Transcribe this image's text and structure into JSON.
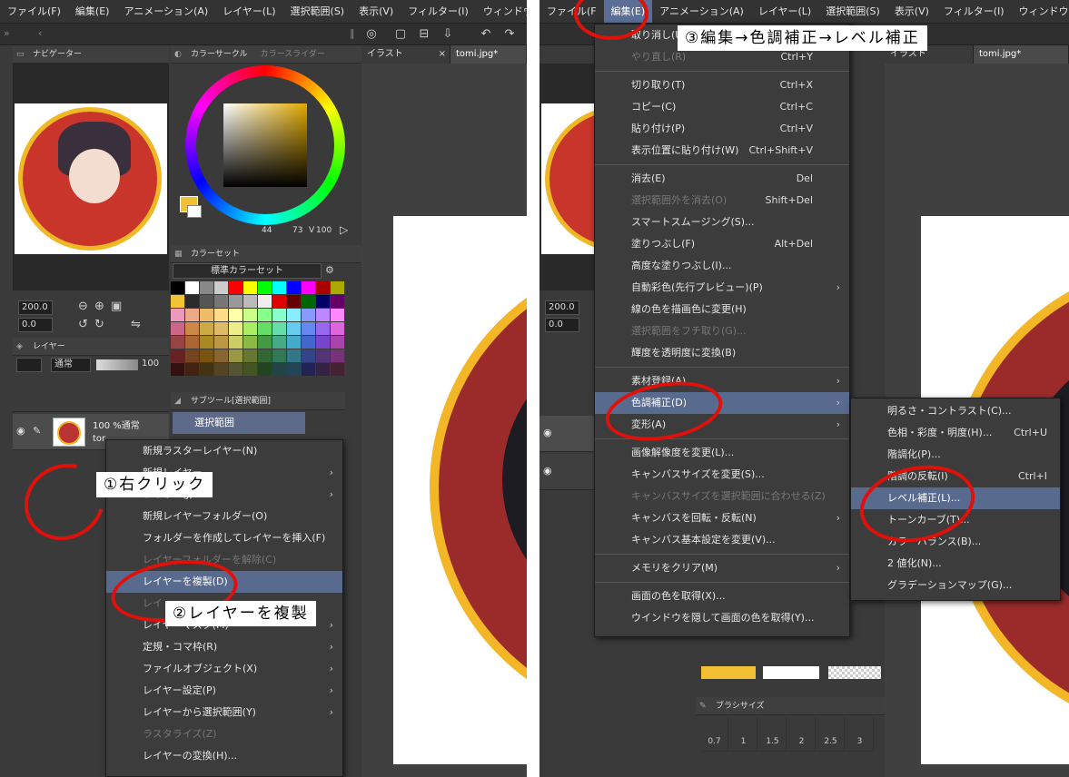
{
  "menus": {
    "left": [
      "ファイル(F)",
      "編集(E)",
      "アニメーション(A)",
      "レイヤー(L)",
      "選択範囲(S)",
      "表示(V)",
      "フィルター(I)",
      "ウィンドウ(W"
    ],
    "right": [
      "ファイル(F",
      "編集(E)",
      "アニメーション(A)",
      "レイヤー(L)",
      "選択範囲(S)",
      "表示(V)",
      "フィルター(I)",
      "ウィンドウ(W)"
    ]
  },
  "panels": {
    "navigator": "ナビゲーター",
    "color_circle": "カラーサークル",
    "color_slider": "カラースライダー",
    "color_set": "カラーセット",
    "color_set_name": "標準カラーセット",
    "layer": "レイヤー",
    "sub_tool": "サブツール[選択範囲]",
    "sub_tool_item": "選択範囲",
    "brush_size": "ブラシサイズ"
  },
  "color_values": {
    "h": "44",
    "s": "73",
    "v": "V",
    "v_val": "100"
  },
  "nav": {
    "zoom": "200.0",
    "angle": "0.0"
  },
  "layer": {
    "blend": "通常",
    "opacity": "100",
    "row_label": "100 %通常",
    "row_name": "tor"
  },
  "tabs": {
    "illust": "イラスト",
    "file": "tomi.jpg*"
  },
  "context_menu": {
    "items": [
      {
        "label": "新規ラスターレイヤー(N)",
        "dis": false,
        "arrow": false
      },
      {
        "label": "新規レイヤー",
        "dis": false,
        "arrow": true
      },
      {
        "label": "レイヤー(J)",
        "dis": false,
        "arrow": true
      },
      {
        "label": "新規レイヤーフォルダー(O)",
        "dis": false,
        "arrow": false
      },
      {
        "label": "フォルダーを作成してレイヤーを挿入(F)",
        "dis": false,
        "arrow": false
      },
      {
        "label": "レイヤーフォルダーを解除(C)",
        "dis": true,
        "arrow": false
      },
      {
        "label": "レイヤーを複製(D)",
        "dis": false,
        "arrow": false,
        "sel": true
      },
      {
        "label": "レイ",
        "dis": true,
        "arrow": false
      },
      {
        "label": "レイヤーマスク(M)",
        "dis": false,
        "arrow": true
      },
      {
        "label": "定規・コマ枠(R)",
        "dis": false,
        "arrow": true
      },
      {
        "label": "ファイルオブジェクト(X)",
        "dis": false,
        "arrow": true
      },
      {
        "label": "レイヤー設定(P)",
        "dis": false,
        "arrow": true
      },
      {
        "label": "レイヤーから選択範囲(Y)",
        "dis": false,
        "arrow": true
      },
      {
        "label": "ラスタライズ(Z)",
        "dis": true,
        "arrow": false
      },
      {
        "label": "レイヤーの変換(H)...",
        "dis": false,
        "arrow": false
      }
    ]
  },
  "edit_menu": {
    "items": [
      {
        "label": "取り消し(U)",
        "sc": "",
        "dis": false
      },
      {
        "label": "やり直し(R)",
        "sc": "Ctrl+Y",
        "dis": true
      },
      {
        "sep": true
      },
      {
        "label": "切り取り(T)",
        "sc": "Ctrl+X"
      },
      {
        "label": "コピー(C)",
        "sc": "Ctrl+C"
      },
      {
        "label": "貼り付け(P)",
        "sc": "Ctrl+V"
      },
      {
        "label": "表示位置に貼り付け(W)",
        "sc": "Ctrl+Shift+V"
      },
      {
        "sep": true
      },
      {
        "label": "消去(E)",
        "sc": "Del"
      },
      {
        "label": "選択範囲外を消去(O)",
        "sc": "Shift+Del",
        "dis": true
      },
      {
        "label": "スマートスムージング(S)...",
        "sc": ""
      },
      {
        "label": "塗りつぶし(F)",
        "sc": "Alt+Del"
      },
      {
        "label": "高度な塗りつぶし(I)...",
        "sc": ""
      },
      {
        "label": "自動彩色(先行プレビュー)(P)",
        "sc": "",
        "arrow": true
      },
      {
        "label": "線の色を描画色に変更(H)",
        "sc": ""
      },
      {
        "label": "選択範囲をフチ取り(G)...",
        "sc": "",
        "dis": true
      },
      {
        "label": "輝度を透明度に変換(B)",
        "sc": ""
      },
      {
        "sep": true
      },
      {
        "label": "素材登録(A)",
        "sc": "",
        "arrow": true
      },
      {
        "label": "色調補正(D)",
        "sc": "",
        "arrow": true,
        "sel": true
      },
      {
        "label": "変形(A)",
        "sc": "",
        "arrow": true
      },
      {
        "sep": true
      },
      {
        "label": "画像解像度を変更(L)...",
        "sc": ""
      },
      {
        "label": "キャンバスサイズを変更(S)...",
        "sc": ""
      },
      {
        "label": "キャンバスサイズを選択範囲に合わせる(Z)",
        "sc": "",
        "dis": true
      },
      {
        "label": "キャンバスを回転・反転(N)",
        "sc": "",
        "arrow": true
      },
      {
        "label": "キャンバス基本設定を変更(V)...",
        "sc": ""
      },
      {
        "sep": true
      },
      {
        "label": "メモリをクリア(M)",
        "sc": "",
        "arrow": true
      },
      {
        "sep": true
      },
      {
        "label": "画面の色を取得(X)...",
        "sc": ""
      },
      {
        "label": "ウインドウを隠して画面の色を取得(Y)...",
        "sc": ""
      }
    ]
  },
  "tone_menu": {
    "items": [
      {
        "label": "明るさ・コントラスト(C)...",
        "sc": ""
      },
      {
        "label": "色相・彩度・明度(H)...",
        "sc": "Ctrl+U"
      },
      {
        "label": "階調化(P)...",
        "sc": ""
      },
      {
        "label": "階調の反転(I)",
        "sc": "Ctrl+I"
      },
      {
        "label": "レベル補正(L)...",
        "sc": "",
        "sel": true
      },
      {
        "label": "トーンカーブ(T)...",
        "sc": ""
      },
      {
        "label": "カラーバランス(B)...",
        "sc": ""
      },
      {
        "label": "2 値化(N)...",
        "sc": ""
      },
      {
        "label": "グラデーションマップ(G)...",
        "sc": ""
      }
    ]
  },
  "notes": {
    "n1": "①右クリック",
    "n2": "②レイヤーを複製",
    "n3": "③編集→色調補正→レベル補正"
  },
  "brush_sizes": [
    "0.7",
    "1",
    "1.5",
    "2",
    "2.5",
    "3"
  ]
}
